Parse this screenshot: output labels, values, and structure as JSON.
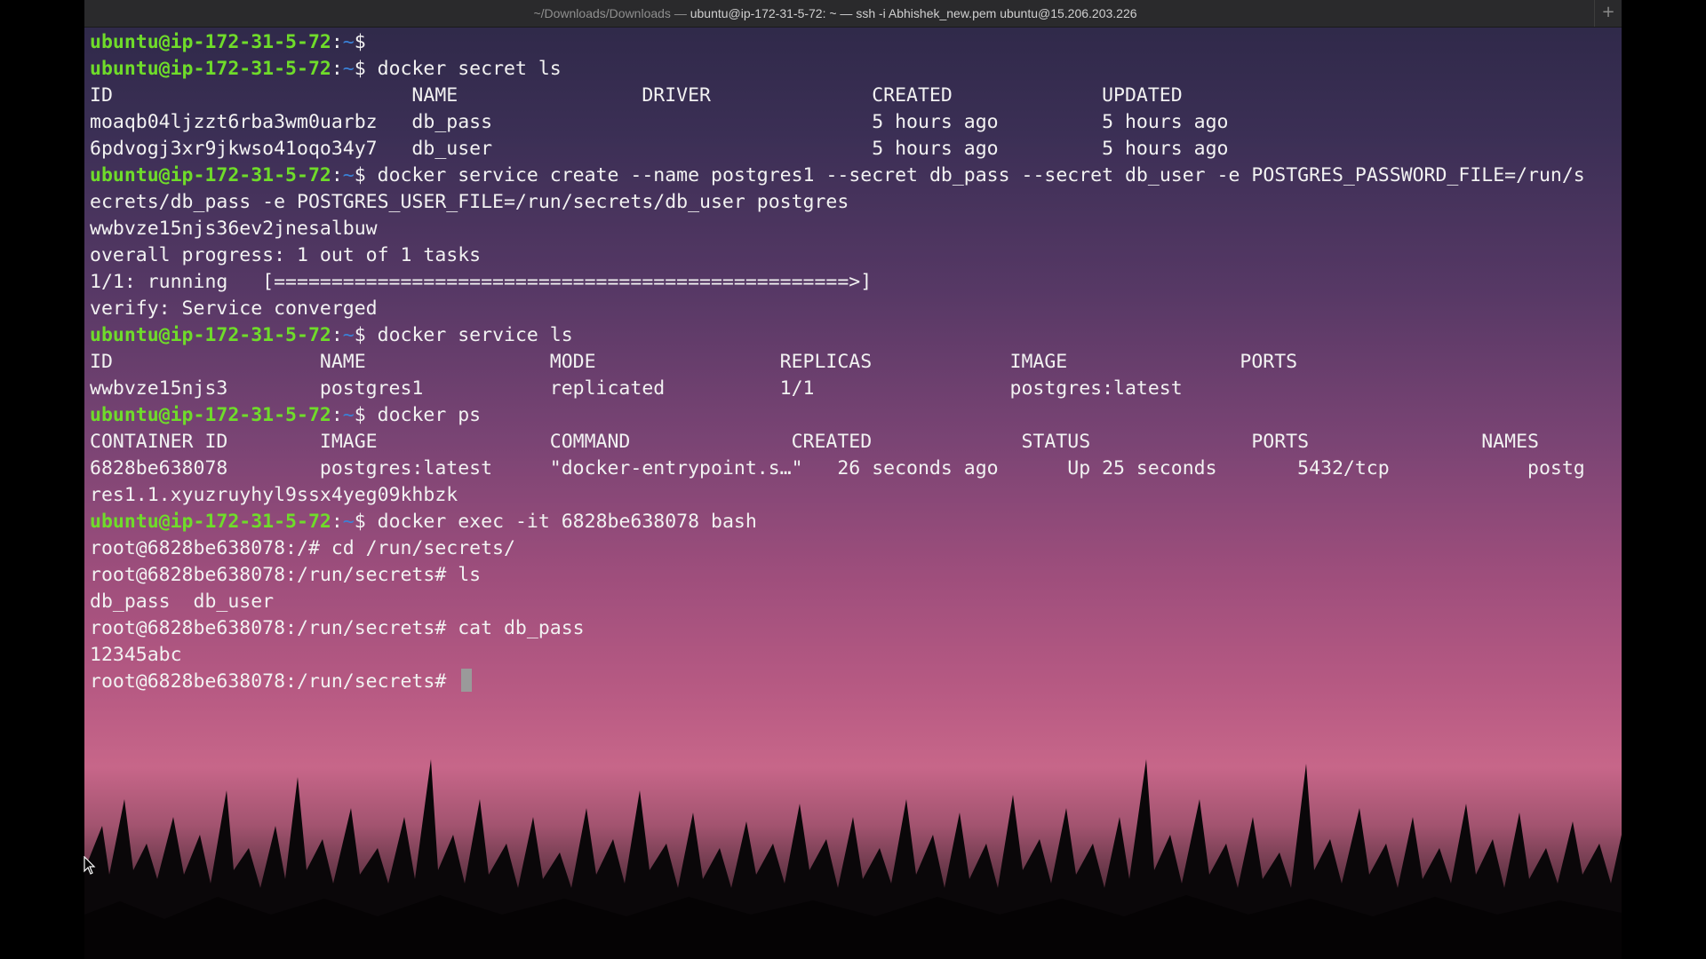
{
  "window": {
    "title_prefix": "~/Downloads/Downloads — ",
    "title_main": "ubuntu@ip-172-31-5-72: ~ — ssh -i Abhishek_new.pem ubuntu@15.206.203.226",
    "new_tab_label": "+"
  },
  "terminal": {
    "prompt_user": "ubuntu@ip-172-31-5-72",
    "prompt_sep": ":",
    "prompt_dir": "~",
    "prompt_end": "$ ",
    "lines": [
      {
        "type": "prompt",
        "cmd": ""
      },
      {
        "type": "prompt",
        "cmd": "docker secret ls"
      },
      {
        "type": "out",
        "text": "ID                          NAME                DRIVER              CREATED             UPDATED"
      },
      {
        "type": "out",
        "text": "moaqb04ljzzt6rba3wm0uarbz   db_pass                                 5 hours ago         5 hours ago"
      },
      {
        "type": "out",
        "text": "6pdvogj3xr9jkwso41oqo34y7   db_user                                 5 hours ago         5 hours ago"
      },
      {
        "type": "prompt",
        "cmd": "docker service create --name postgres1 --secret db_pass --secret db_user -e POSTGRES_PASSWORD_FILE=/run/s"
      },
      {
        "type": "out",
        "text": "ecrets/db_pass -e POSTGRES_USER_FILE=/run/secrets/db_user postgres"
      },
      {
        "type": "out",
        "text": "wwbvze15njs36ev2jnesalbuw"
      },
      {
        "type": "out",
        "text": "overall progress: 1 out of 1 tasks"
      },
      {
        "type": "out",
        "text": "1/1: running   [==================================================>]"
      },
      {
        "type": "out",
        "text": "verify: Service converged"
      },
      {
        "type": "prompt",
        "cmd": "docker service ls"
      },
      {
        "type": "out",
        "text": "ID                  NAME                MODE                REPLICAS            IMAGE               PORTS"
      },
      {
        "type": "out",
        "text": "wwbvze15njs3        postgres1           replicated          1/1                 postgres:latest"
      },
      {
        "type": "prompt",
        "cmd": "docker ps"
      },
      {
        "type": "out",
        "text": "CONTAINER ID        IMAGE               COMMAND              CREATED             STATUS              PORTS               NAMES"
      },
      {
        "type": "out",
        "text": "6828be638078        postgres:latest     \"docker-entrypoint.s…\"   26 seconds ago      Up 25 seconds       5432/tcp            postg"
      },
      {
        "type": "out",
        "text": "res1.1.xyuzruyhyl9ssx4yeg09khbzk"
      },
      {
        "type": "prompt",
        "cmd": "docker exec -it 6828be638078 bash"
      },
      {
        "type": "out",
        "text": "root@6828be638078:/# cd /run/secrets/"
      },
      {
        "type": "out",
        "text": "root@6828be638078:/run/secrets# ls"
      },
      {
        "type": "out",
        "text": "db_pass  db_user"
      },
      {
        "type": "out",
        "text": "root@6828be638078:/run/secrets# cat db_pass"
      },
      {
        "type": "out",
        "text": "12345abc"
      },
      {
        "type": "cursor",
        "text": "root@6828be638078:/run/secrets# "
      }
    ]
  },
  "colors": {
    "prompt_green": "#6fdc2a",
    "tilde_blue": "#3a82d8",
    "text": "#f2f2f2"
  },
  "icons": {
    "new_tab": "plus-icon",
    "pointer": "mouse-pointer-icon"
  }
}
